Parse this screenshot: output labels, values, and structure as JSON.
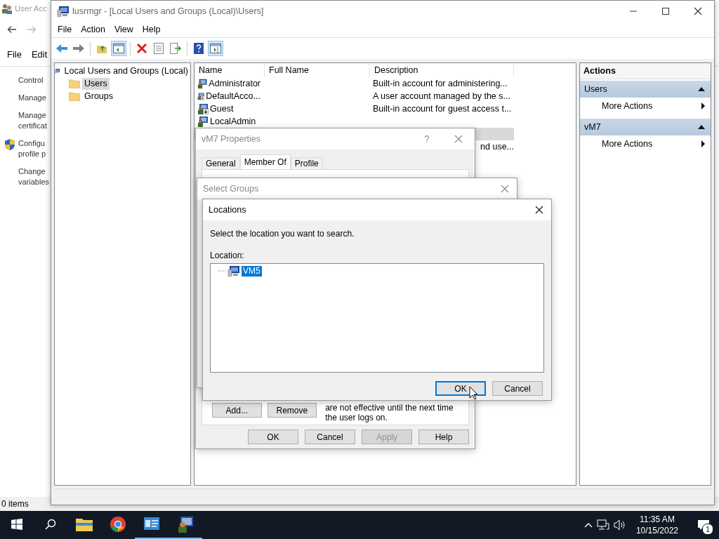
{
  "background_window": {
    "title": "User Acc",
    "menu": [
      "File",
      "Edit"
    ],
    "links": [
      {
        "lines": [
          "Control"
        ],
        "kind": "plain"
      },
      {
        "lines": [
          "Manage"
        ],
        "kind": "plain"
      },
      {
        "lines": [
          "Manage",
          "certificat"
        ],
        "kind": "plain"
      },
      {
        "lines": [
          "Configu",
          "profile p"
        ],
        "kind": "shield"
      },
      {
        "lines": [
          "Change",
          "variables"
        ],
        "kind": "plain"
      }
    ],
    "status": "0 items"
  },
  "main_window": {
    "title": "lusrmgr - [Local Users and Groups (Local)\\Users]",
    "menu": [
      "File",
      "Action",
      "View",
      "Help"
    ],
    "toolbar": [
      {
        "kind": "back",
        "pressed": false
      },
      {
        "kind": "forward",
        "pressed": false
      },
      {
        "kind": "sep"
      },
      {
        "kind": "up",
        "pressed": false
      },
      {
        "kind": "tree",
        "pressed": true
      },
      {
        "kind": "sep"
      },
      {
        "kind": "delete",
        "pressed": false
      },
      {
        "kind": "properties",
        "pressed": false
      },
      {
        "kind": "export",
        "pressed": false
      },
      {
        "kind": "sep"
      },
      {
        "kind": "help",
        "pressed": false
      },
      {
        "kind": "actionpane",
        "pressed": true
      }
    ],
    "tree": {
      "label": "Local Users and Groups (Local)",
      "children": [
        {
          "label": "Users",
          "selected": true
        },
        {
          "label": "Groups",
          "selected": false
        }
      ]
    },
    "columns": [
      "Name",
      "Full Name",
      "Description"
    ],
    "rows": [
      {
        "name": "Administrator",
        "description": "Built-in account for administering...",
        "disabled": false,
        "selected": false
      },
      {
        "name": "DefaultAcco...",
        "description": "A user account managed by the s...",
        "disabled": true,
        "selected": false
      },
      {
        "name": "Guest",
        "description": "Built-in account for guest access t...",
        "disabled": true,
        "selected": false
      },
      {
        "name": "LocalAdmin",
        "disabled": false,
        "selected": false
      },
      {
        "selected": true
      },
      {
        "description": "nd use...",
        "selected": false
      }
    ],
    "actions": {
      "title": "Actions",
      "sections": [
        {
          "label": "Users",
          "expanded": true,
          "items": [
            "More Actions"
          ]
        },
        {
          "label": "vM7",
          "expanded": true,
          "items": [
            "More Actions"
          ]
        }
      ]
    }
  },
  "properties_dialog": {
    "title": "vM7 Properties",
    "help": "?",
    "tabs": [
      {
        "label": "General",
        "selected": false
      },
      {
        "label": "Member Of",
        "selected": true
      },
      {
        "label": "Profile",
        "selected": false
      }
    ],
    "member_buttons": [
      "Add...",
      "Remove"
    ],
    "note": "are not effective until the next time the user logs on.",
    "buttons": [
      {
        "label": "OK",
        "disabled": false
      },
      {
        "label": "Cancel",
        "disabled": false
      },
      {
        "label": "Apply",
        "disabled": true
      },
      {
        "label": "Help",
        "disabled": false
      }
    ]
  },
  "select_groups_dialog": {
    "title": "Select Groups"
  },
  "locations_dialog": {
    "title": "Locations",
    "prompt": "Select the location you want to search.",
    "location_label": "Location:",
    "tree": [
      {
        "label": "VM5",
        "selected": true
      }
    ],
    "buttons": [
      {
        "label": "OK",
        "default": true
      },
      {
        "label": "Cancel",
        "default": false
      }
    ]
  },
  "taskbar": {
    "apps": [
      {
        "kind": "explorer",
        "active": false
      },
      {
        "kind": "chrome",
        "active": false
      },
      {
        "kind": "users",
        "active": true
      },
      {
        "kind": "lusrmgr",
        "active": true
      }
    ],
    "time": "11:35 AM",
    "date": "10/15/2022",
    "notifications": "1"
  }
}
